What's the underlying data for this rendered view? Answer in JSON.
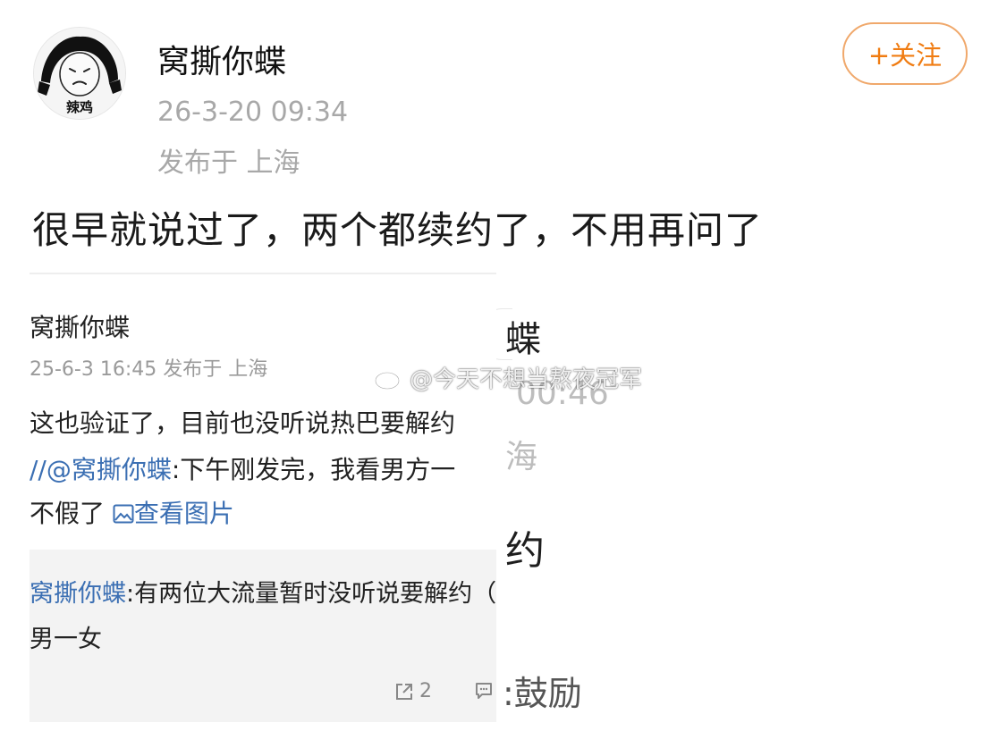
{
  "author": {
    "name": "窝撕你蝶",
    "avatar_caption": "辣鸡",
    "time": "26-3-20 09:34",
    "location": "发布于 上海"
  },
  "follow_label": "+关注",
  "post_text": "很早就说过了，两个都续约了，不用再问了",
  "embedded_screenshot": {
    "name": "窝撕你蝶",
    "meta": "25-6-3 16:45  发布于 上海",
    "line1": "这也验证了，目前也没听说热巴要解约",
    "line2_mention": "//@窝撕你蝶",
    "line2_text": ":下午刚发完，我看男方一",
    "line3_text": "不假了 ",
    "view_images_label": "查看图片",
    "quote_mention": "窝撕你蝶",
    "quote_line1_text": ":有两位大流量暂时没听说要解约（不",
    "quote_line2": "男一女",
    "repost_count": "2"
  },
  "background_fragments": {
    "name": "蝶",
    "time": "00:46",
    "location": "海",
    "text": "约",
    "bottom": ":鼓励"
  },
  "watermark": "@今天不想当熬夜冠军",
  "colors": {
    "follow_orange": "#f07c12",
    "mention_blue": "#3b6fb3",
    "meta_gray": "#a8a8a8"
  }
}
